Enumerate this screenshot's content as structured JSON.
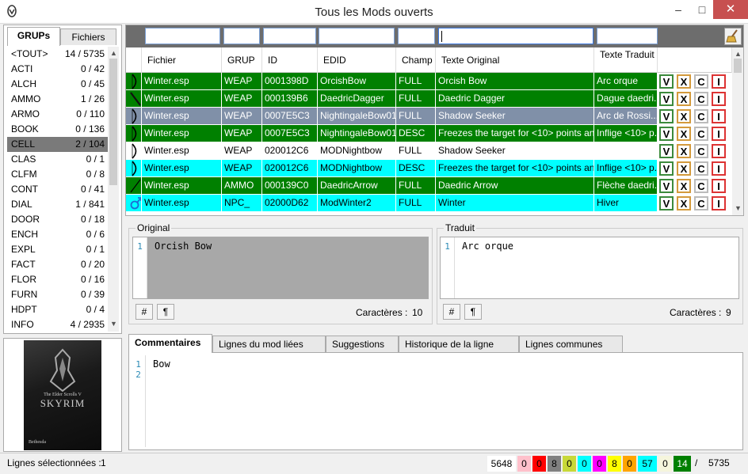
{
  "window": {
    "title": "Tous les Mods ouverts",
    "min": "–",
    "max": "□",
    "close": "✕"
  },
  "left_tabs": [
    "GRUPs",
    "Fichiers"
  ],
  "groups": [
    {
      "name": "<TOUT>",
      "count": "14 / 5735"
    },
    {
      "name": "ACTI",
      "count": "0 / 42"
    },
    {
      "name": "ALCH",
      "count": "0 / 45"
    },
    {
      "name": "AMMO",
      "count": "1 / 26"
    },
    {
      "name": "ARMO",
      "count": "0 / 110"
    },
    {
      "name": "BOOK",
      "count": "0 / 136"
    },
    {
      "name": "CELL",
      "count": "2 / 104"
    },
    {
      "name": "CLAS",
      "count": "0 / 1"
    },
    {
      "name": "CLFM",
      "count": "0 / 8"
    },
    {
      "name": "CONT",
      "count": "0 / 41"
    },
    {
      "name": "DIAL",
      "count": "1 / 841"
    },
    {
      "name": "DOOR",
      "count": "0 / 18"
    },
    {
      "name": "ENCH",
      "count": "0 / 6"
    },
    {
      "name": "EXPL",
      "count": "0 / 1"
    },
    {
      "name": "FACT",
      "count": "0 / 20"
    },
    {
      "name": "FLOR",
      "count": "0 / 16"
    },
    {
      "name": "FURN",
      "count": "0 / 39"
    },
    {
      "name": "HDPT",
      "count": "0 / 4"
    },
    {
      "name": "INFO",
      "count": "4 / 2935"
    }
  ],
  "cover": {
    "series": "The Elder Scrolls V",
    "title": "SKYRIM",
    "publisher": "Bethesda"
  },
  "columns": [
    "Fichier",
    "GRUP",
    "ID",
    "EDID",
    "Champ",
    "Texte Original",
    "Texte Traduit"
  ],
  "action_labels": [
    "V",
    "X",
    "C",
    "I"
  ],
  "rows": [
    {
      "file": "Winter.esp",
      "grup": "WEAP",
      "id": "0001398D",
      "edid": "OrcishBow",
      "field": "FULL",
      "orig": "Orcish Bow",
      "trad": "Arc orque",
      "bg": "#008000",
      "fg": "#ffffff",
      "icon": "bow-icon"
    },
    {
      "file": "Winter.esp",
      "grup": "WEAP",
      "id": "000139B6",
      "edid": "DaedricDagger",
      "field": "FULL",
      "orig": "Daedric Dagger",
      "trad": "Dague daedri...",
      "bg": "#008000",
      "fg": "#ffffff",
      "icon": "dagger-icon"
    },
    {
      "file": "Winter.esp",
      "grup": "WEAP",
      "id": "0007E5C3",
      "edid": "NightingaleBow01",
      "field": "FULL",
      "orig": "Shadow Seeker",
      "trad": "Arc de Rossi...",
      "bg": "#8090a8",
      "fg": "#ffffff",
      "icon": "bow-icon"
    },
    {
      "file": "Winter.esp",
      "grup": "WEAP",
      "id": "0007E5C3",
      "edid": "NightingaleBow01",
      "field": "DESC",
      "orig": "Freezes the target for <10> points and ...",
      "trad": "Inflige <10> p...",
      "bg": "#008000",
      "fg": "#ffffff",
      "icon": "bow-icon"
    },
    {
      "file": "Winter.esp",
      "grup": "WEAP",
      "id": "020012C6",
      "edid": "MODNightbow",
      "field": "FULL",
      "orig": "Shadow Seeker",
      "trad": "",
      "bg": "#ffffff",
      "fg": "#000000",
      "icon": "bow-icon"
    },
    {
      "file": "Winter.esp",
      "grup": "WEAP",
      "id": "020012C6",
      "edid": "MODNightbow",
      "field": "DESC",
      "orig": "Freezes the target for <10> points and ...",
      "trad": "Inflige <10> p...",
      "bg": "#00ffff",
      "fg": "#000000",
      "icon": "bow-icon"
    },
    {
      "file": "Winter.esp",
      "grup": "AMMO",
      "id": "000139C0",
      "edid": "DaedricArrow",
      "field": "FULL",
      "orig": "Daedric Arrow",
      "trad": "Flèche daedri...",
      "bg": "#008000",
      "fg": "#ffffff",
      "icon": "arrow-icon"
    },
    {
      "file": "Winter.esp",
      "grup": "NPC_",
      "id": "02000D62",
      "edid": "ModWinter2",
      "field": "FULL",
      "orig": "Winter",
      "trad": "Hiver",
      "bg": "#00ffff",
      "fg": "#000000",
      "icon": "npc-male-icon"
    }
  ],
  "original": {
    "label": "Original",
    "lines": [
      "1"
    ],
    "text": "Orcish Bow",
    "chars_label": "Caractères :",
    "chars": "10"
  },
  "traduit": {
    "label": "Traduit",
    "lines": [
      "1"
    ],
    "text": "Arc orque",
    "chars_label": "Caractères :",
    "chars": "9"
  },
  "btn_hash": "#",
  "btn_pilcrow": "¶",
  "bottom_tabs": [
    "Commentaires",
    "Lignes du mod liées",
    "Suggestions",
    "Historique de la ligne",
    "Lignes communes"
  ],
  "comment": {
    "lines": [
      "1",
      "2"
    ],
    "text": "Bow"
  },
  "status": {
    "label": "Lignes sélectionnées :",
    "value": "1",
    "counters": [
      {
        "v": "5648",
        "bg": "#ffffff",
        "fg": "#000000"
      },
      {
        "v": "0",
        "bg": "#ffc0cb",
        "fg": "#000000"
      },
      {
        "v": "0",
        "bg": "#ff0000",
        "fg": "#000000"
      },
      {
        "v": "8",
        "bg": "#808080",
        "fg": "#000000"
      },
      {
        "v": "0",
        "bg": "#c8d838",
        "fg": "#000000"
      },
      {
        "v": "0",
        "bg": "#00ffff",
        "fg": "#000000"
      },
      {
        "v": "0",
        "bg": "#ff00ff",
        "fg": "#000000"
      },
      {
        "v": "8",
        "bg": "#ffff00",
        "fg": "#000000"
      },
      {
        "v": "0",
        "bg": "#ffa500",
        "fg": "#000000"
      },
      {
        "v": "57",
        "bg": "#00ffff",
        "fg": "#000000"
      },
      {
        "v": "0",
        "bg": "#f5f5dc",
        "fg": "#000000"
      },
      {
        "v": "14",
        "bg": "#008000",
        "fg": "#ffffff"
      }
    ],
    "sep": "/",
    "total": "5735"
  }
}
